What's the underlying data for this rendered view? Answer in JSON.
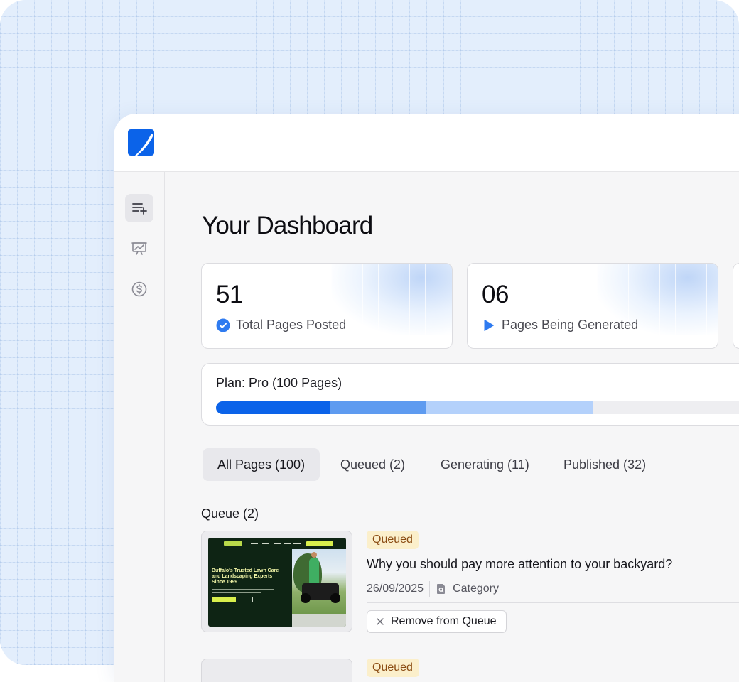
{
  "dashboard": {
    "title": "Your Dashboard"
  },
  "stats": [
    {
      "value": "51",
      "label": "Total Pages Posted",
      "icon": "check-circle-icon"
    },
    {
      "value": "06",
      "label": "Pages Being Generated",
      "icon": "play-icon"
    }
  ],
  "plan": {
    "label": "Plan: Pro (100 Pages)",
    "progress_segments": [
      {
        "name": "published",
        "fraction": 0.2,
        "color": "#0b63e9"
      },
      {
        "name": "generating",
        "fraction": 0.17,
        "color": "#5e9bf0"
      },
      {
        "name": "queued",
        "fraction": 0.295,
        "color": "#b4d1fb"
      }
    ]
  },
  "tabs": [
    {
      "label": "All Pages (100)",
      "active": true
    },
    {
      "label": "Queued (2)",
      "active": false
    },
    {
      "label": "Generating (11)",
      "active": false
    },
    {
      "label": "Published (32)",
      "active": false
    }
  ],
  "queue": {
    "title": "Queue (2)",
    "items": [
      {
        "status": "Queued",
        "title": "Why you should pay more attention to your backyard?",
        "date": "26/09/2025",
        "category": "Category",
        "action": "Remove from Queue",
        "thumbnail": {
          "headline": "Buffalo's Trusted Lawn Care and Landscaping Experts Since 1999"
        }
      },
      {
        "status": "Queued"
      }
    ]
  },
  "sidebar": {
    "items": [
      {
        "icon": "add-list-icon",
        "active": true
      },
      {
        "icon": "presentation-chart-icon",
        "active": false
      },
      {
        "icon": "dollar-circle-icon",
        "active": false
      }
    ]
  },
  "colors": {
    "brand": "#0b63e9",
    "badge_bg": "#fbefcb",
    "badge_text": "#8a4b12"
  }
}
